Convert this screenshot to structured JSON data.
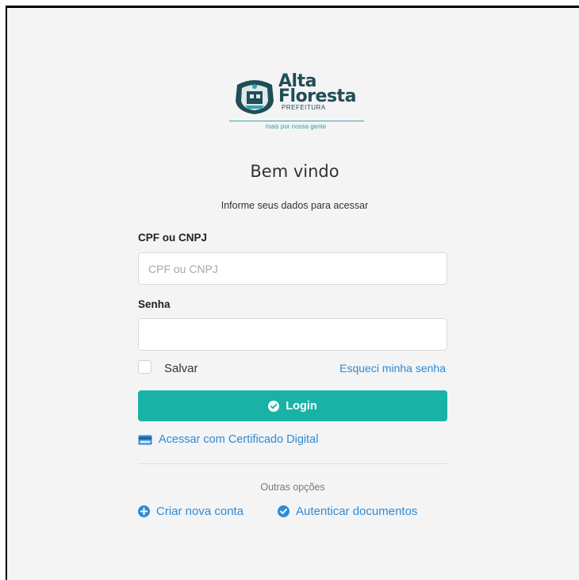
{
  "logo": {
    "name_line1": "Alta",
    "name_line2": "Floresta",
    "sub": "PREFEITURA",
    "tagline": "mais por nossa gente"
  },
  "header": {
    "title": "Bem vindo",
    "subtitle": "Informe seus dados para acessar"
  },
  "form": {
    "cpf_label": "CPF ou CNPJ",
    "cpf_placeholder": "CPF ou CNPJ",
    "cpf_value": "",
    "password_label": "Senha",
    "password_value": "",
    "remember_label": "Salvar",
    "remember_checked": false,
    "forgot_link": "Esqueci minha senha",
    "login_button": "Login",
    "certificate_link": "Acessar com Certificado Digital"
  },
  "other_options": {
    "label": "Outras opções",
    "create_account": "Criar nova conta",
    "authenticate_docs": "Autenticar documentos"
  },
  "colors": {
    "accent": "#18b3a6",
    "link": "#2e8bd6",
    "logo_dark": "#1f4e57",
    "background": "#f4f4f4"
  },
  "icons": {
    "login": "check-circle-icon",
    "certificate": "credit-card-icon",
    "create_account": "plus-circle-icon",
    "authenticate": "check-circle-icon"
  }
}
